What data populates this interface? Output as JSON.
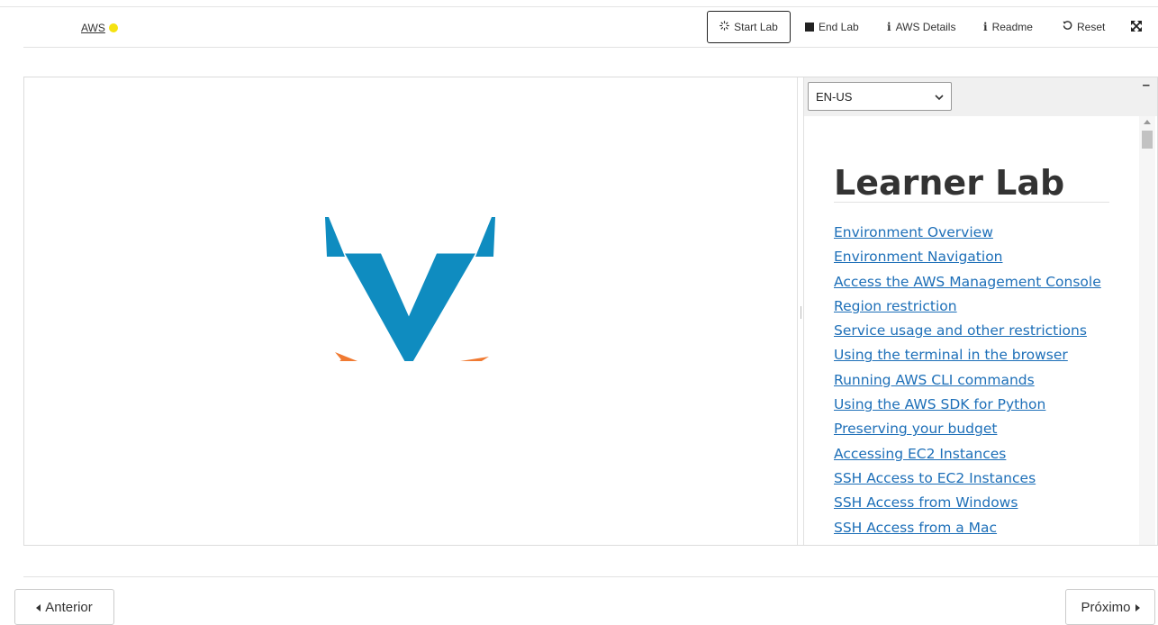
{
  "toolbar": {
    "aws_label": "AWS",
    "status_color": "#f5e211",
    "start_lab": "Start Lab",
    "end_lab": "End Lab",
    "aws_details": "AWS Details",
    "readme": "Readme",
    "reset": "Reset",
    "info_glyph": "i",
    "fullscreen_glyph": "⤧"
  },
  "logo": {
    "primary_color": "#0f8cc0",
    "accent_color": "#f07a32",
    "icon": "vocareum-v-logo"
  },
  "readme_panel": {
    "language": "EN-US",
    "minimize_glyph": "–",
    "title": "Learner Lab",
    "toc": [
      "Environment Overview",
      "Environment Navigation",
      "Access the AWS Management Console",
      "Region restriction",
      "Service usage and other restrictions",
      "Using the terminal in the browser",
      "Running AWS CLI commands",
      "Using the AWS SDK for Python",
      "Preserving your budget",
      "Accessing EC2 Instances",
      "SSH Access to EC2 Instances",
      "SSH Access from Windows",
      "SSH Access from a Mac"
    ]
  },
  "navigation": {
    "previous": "Anterior",
    "next": "Próximo"
  },
  "colors": {
    "link": "#1d6fb8"
  }
}
